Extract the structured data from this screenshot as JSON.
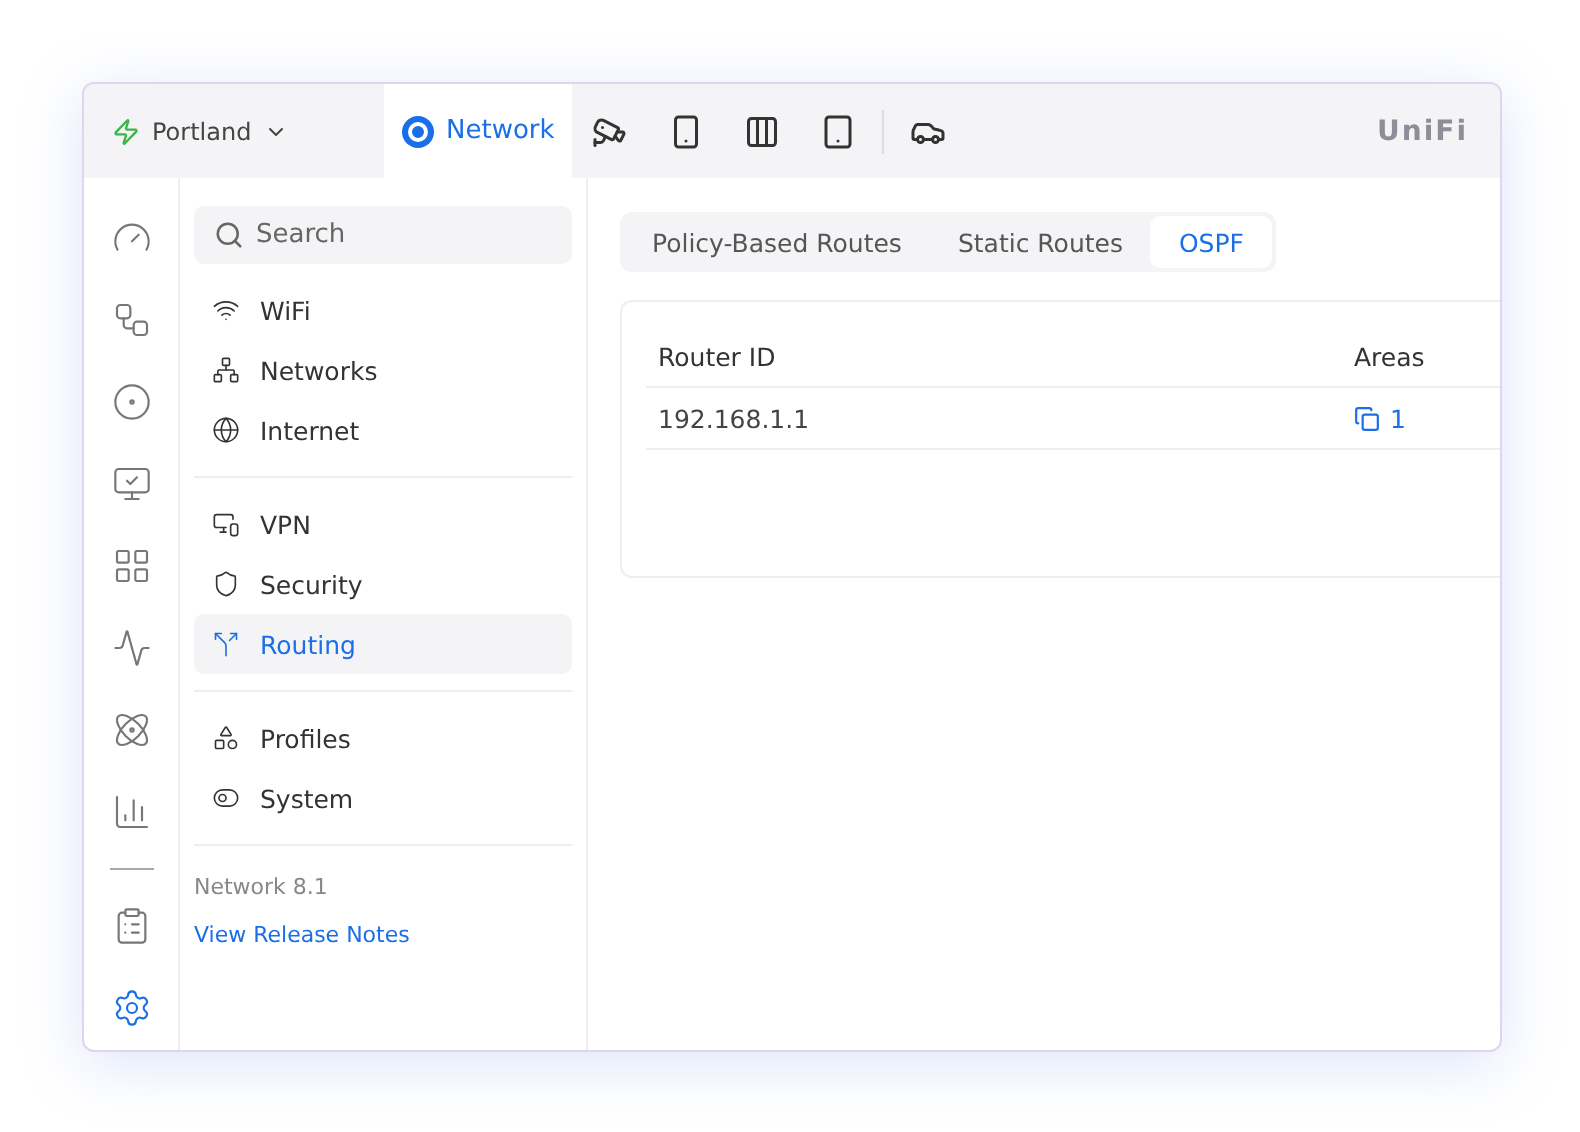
{
  "site": {
    "name": "Portland"
  },
  "apps": [
    {
      "label": "Network",
      "selected": true
    },
    {
      "selected": false
    },
    {
      "selected": false
    },
    {
      "selected": false
    },
    {
      "selected": false
    },
    {
      "selected": false
    }
  ],
  "brand": "UniFi",
  "rail": [
    {
      "selected": false
    },
    {
      "selected": false
    },
    {
      "selected": false
    },
    {
      "selected": false
    },
    {
      "selected": false
    },
    {
      "selected": false
    },
    {
      "selected": false
    },
    {
      "selected": false
    },
    {
      "selected": false
    },
    {
      "selected": true
    }
  ],
  "search": {
    "placeholder": "Search"
  },
  "sidebar": {
    "groups": [
      [
        {
          "label": "WiFi",
          "selected": false
        },
        {
          "label": "Networks",
          "selected": false
        },
        {
          "label": "Internet",
          "selected": false
        }
      ],
      [
        {
          "label": "VPN",
          "selected": false
        },
        {
          "label": "Security",
          "selected": false
        },
        {
          "label": "Routing",
          "selected": true
        }
      ],
      [
        {
          "label": "Profiles",
          "selected": false
        },
        {
          "label": "System",
          "selected": false
        }
      ]
    ],
    "version": "Network 8.1",
    "release_notes": "View Release Notes"
  },
  "tabs": [
    {
      "label": "Policy-Based Routes",
      "selected": false
    },
    {
      "label": "Static Routes",
      "selected": false
    },
    {
      "label": "OSPF",
      "selected": true
    }
  ],
  "table": {
    "columns": [
      "Router ID",
      "Areas"
    ],
    "rows": [
      {
        "router_id": "192.168.1.1",
        "areas": "1"
      }
    ]
  }
}
